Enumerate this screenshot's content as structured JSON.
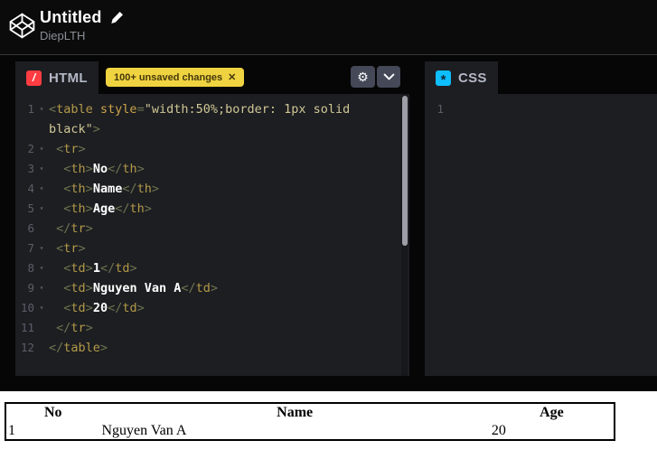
{
  "header": {
    "title": "Untitled",
    "username": "DiepLTH"
  },
  "panels": {
    "html": {
      "label": "HTML",
      "icon_glyph": "/",
      "badge": {
        "text": "100+ unsaved changes",
        "close_glyph": "✕"
      }
    },
    "css": {
      "label": "CSS",
      "icon_glyph": "*",
      "line_number": "1"
    }
  },
  "icons": {
    "gear": "⚙",
    "fold_arrow": "▾"
  },
  "colors": {
    "html_accent": "#ff3c41",
    "css_accent": "#0ebeff",
    "badge_yellow": "#f0d340",
    "editor_bg": "#1d1e22",
    "button_gray": "#444857"
  },
  "editor": {
    "rows": [
      {
        "num": "1",
        "fold": true,
        "tokens": [
          [
            "br",
            "<"
          ],
          [
            "tag",
            "table"
          ],
          [
            "pl",
            " "
          ],
          [
            "attr",
            "style"
          ],
          [
            "op",
            "="
          ],
          [
            "str",
            "\"width:50%;border: 1px solid"
          ]
        ]
      },
      {
        "num": "",
        "fold": false,
        "tokens": [
          [
            "str",
            "black\""
          ],
          [
            "br",
            ">"
          ]
        ]
      },
      {
        "num": "2",
        "fold": true,
        "tokens": [
          [
            "pl",
            " "
          ],
          [
            "br",
            "<"
          ],
          [
            "tag",
            "tr"
          ],
          [
            "br",
            ">"
          ]
        ]
      },
      {
        "num": "3",
        "fold": true,
        "tokens": [
          [
            "pl",
            "  "
          ],
          [
            "br",
            "<"
          ],
          [
            "tag",
            "th"
          ],
          [
            "br",
            ">"
          ],
          [
            "txt",
            "No"
          ],
          [
            "br",
            "</"
          ],
          [
            "tag",
            "th"
          ],
          [
            "br",
            ">"
          ]
        ]
      },
      {
        "num": "4",
        "fold": true,
        "tokens": [
          [
            "pl",
            "  "
          ],
          [
            "br",
            "<"
          ],
          [
            "tag",
            "th"
          ],
          [
            "br",
            ">"
          ],
          [
            "txt",
            "Name"
          ],
          [
            "br",
            "</"
          ],
          [
            "tag",
            "th"
          ],
          [
            "br",
            ">"
          ]
        ]
      },
      {
        "num": "5",
        "fold": true,
        "tokens": [
          [
            "pl",
            "  "
          ],
          [
            "br",
            "<"
          ],
          [
            "tag",
            "th"
          ],
          [
            "br",
            ">"
          ],
          [
            "txt",
            "Age"
          ],
          [
            "br",
            "</"
          ],
          [
            "tag",
            "th"
          ],
          [
            "br",
            ">"
          ]
        ]
      },
      {
        "num": "6",
        "fold": false,
        "tokens": [
          [
            "pl",
            " "
          ],
          [
            "br",
            "</"
          ],
          [
            "tag",
            "tr"
          ],
          [
            "br",
            ">"
          ]
        ]
      },
      {
        "num": "7",
        "fold": true,
        "tokens": [
          [
            "pl",
            " "
          ],
          [
            "br",
            "<"
          ],
          [
            "tag",
            "tr"
          ],
          [
            "br",
            ">"
          ]
        ]
      },
      {
        "num": "8",
        "fold": true,
        "tokens": [
          [
            "pl",
            "  "
          ],
          [
            "br",
            "<"
          ],
          [
            "tag",
            "td"
          ],
          [
            "br",
            ">"
          ],
          [
            "txt",
            "1"
          ],
          [
            "br",
            "</"
          ],
          [
            "tag",
            "td"
          ],
          [
            "br",
            ">"
          ]
        ]
      },
      {
        "num": "9",
        "fold": true,
        "tokens": [
          [
            "pl",
            "  "
          ],
          [
            "br",
            "<"
          ],
          [
            "tag",
            "td"
          ],
          [
            "br",
            ">"
          ],
          [
            "txt",
            "Nguyen Van A"
          ],
          [
            "br",
            "</"
          ],
          [
            "tag",
            "td"
          ],
          [
            "br",
            ">"
          ]
        ]
      },
      {
        "num": "10",
        "fold": true,
        "tokens": [
          [
            "pl",
            "  "
          ],
          [
            "br",
            "<"
          ],
          [
            "tag",
            "td"
          ],
          [
            "br",
            ">"
          ],
          [
            "txt",
            "20"
          ],
          [
            "br",
            "</"
          ],
          [
            "tag",
            "td"
          ],
          [
            "br",
            ">"
          ]
        ]
      },
      {
        "num": "11",
        "fold": false,
        "tokens": [
          [
            "pl",
            " "
          ],
          [
            "br",
            "</"
          ],
          [
            "tag",
            "tr"
          ],
          [
            "br",
            ">"
          ]
        ]
      },
      {
        "num": "12",
        "fold": false,
        "tokens": [
          [
            "br",
            "</"
          ],
          [
            "tag",
            "table"
          ],
          [
            "br",
            ">"
          ]
        ]
      }
    ]
  },
  "preview": {
    "table": {
      "headers": [
        "No",
        "Name",
        "Age"
      ],
      "rows": [
        [
          "1",
          "Nguyen Van A",
          "20"
        ]
      ]
    }
  }
}
